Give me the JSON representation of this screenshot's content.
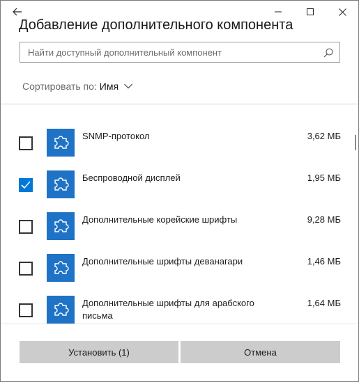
{
  "window": {
    "title": "Добавление дополнительного компонента",
    "controls": {
      "back_icon": "arrow-left-icon",
      "minimize_icon": "minimize-icon",
      "maximize_icon": "maximize-icon",
      "close_icon": "close-icon"
    }
  },
  "search": {
    "placeholder": "Найти доступный дополнительный компонент",
    "value": "",
    "icon": "search-icon"
  },
  "sort": {
    "label": "Сортировать по:",
    "value": "Имя",
    "icon": "chevron-down-icon"
  },
  "features": [
    {
      "name": "SNMP-протокол",
      "size": "3,62 МБ",
      "checked": false,
      "icon": "puzzle-icon"
    },
    {
      "name": "Беспроводной дисплей",
      "size": "1,95 МБ",
      "checked": true,
      "icon": "puzzle-icon"
    },
    {
      "name": "Дополнительные корейские шрифты",
      "size": "9,28 МБ",
      "checked": false,
      "icon": "puzzle-icon"
    },
    {
      "name": "Дополнительные шрифты деванагари",
      "size": "1,46 МБ",
      "checked": false,
      "icon": "puzzle-icon"
    },
    {
      "name": "Дополнительные шрифты для арабского письма",
      "size": "1,64 МБ",
      "checked": false,
      "icon": "puzzle-icon"
    }
  ],
  "buttons": {
    "install": "Установить (1)",
    "cancel": "Отмена"
  },
  "colors": {
    "accent": "#0078d7",
    "tile": "#1e73c7",
    "button_bg": "#cccccc"
  }
}
